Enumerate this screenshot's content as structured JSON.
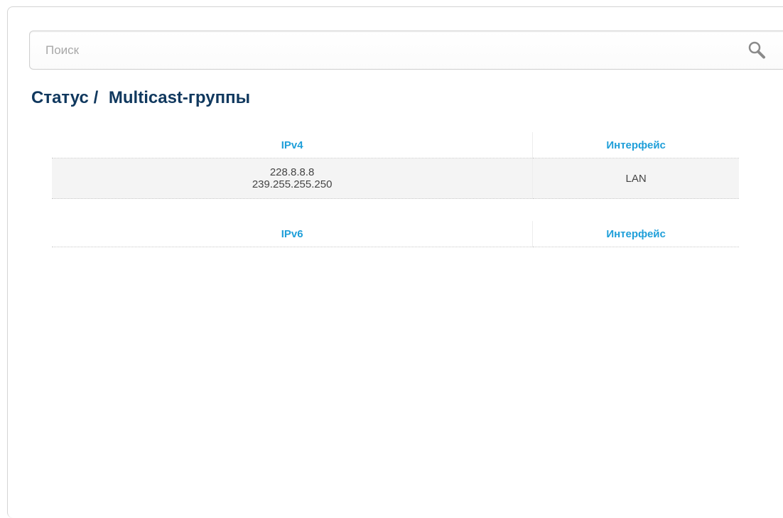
{
  "search": {
    "placeholder": "Поиск",
    "value": ""
  },
  "title": {
    "section": "Статус",
    "separator": "/",
    "page": "Multicast-группы"
  },
  "ipv4_table": {
    "headers": [
      "IPv4",
      "Интерфейс"
    ],
    "rows": [
      {
        "addresses": [
          "228.8.8.8",
          "239.255.255.250"
        ],
        "interface": "LAN"
      }
    ]
  },
  "ipv6_table": {
    "headers": [
      "IPv6",
      "Интерфейс"
    ],
    "rows": []
  },
  "colors": {
    "title": "#10385e",
    "header": "#1f9fd9",
    "row_bg": "#f4f4f4"
  },
  "icons": {
    "search": "search-icon"
  }
}
